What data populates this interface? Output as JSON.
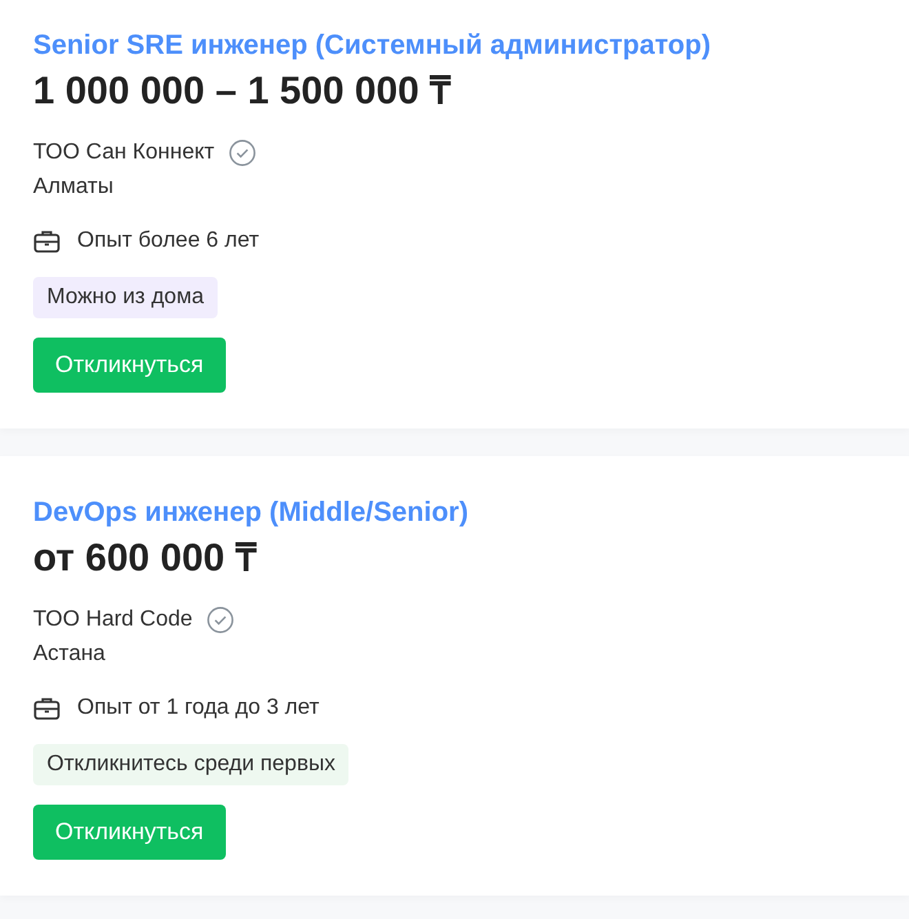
{
  "vacancies": [
    {
      "title": "Senior SRE инженер (Системный администратор)",
      "salary": "1 000 000 – 1 500 000 ₸",
      "company": "ТОО Сан Коннект",
      "verified": true,
      "city": "Алматы",
      "experience": "Опыт более 6 лет",
      "tag": {
        "label": "Можно из дома",
        "color": "#f1edfd"
      },
      "button": "Откликнуться"
    },
    {
      "title": "DevOps инженер (Middle/Senior)",
      "salary": "от 600 000 ₸",
      "company": "ТОО Hard Code",
      "verified": true,
      "city": "Астана",
      "experience": "Опыт от 1 года до 3 лет",
      "tag": {
        "label": "Откликнитесь среди первых",
        "color": "#eef8f0"
      },
      "button": "Откликнуться"
    }
  ]
}
